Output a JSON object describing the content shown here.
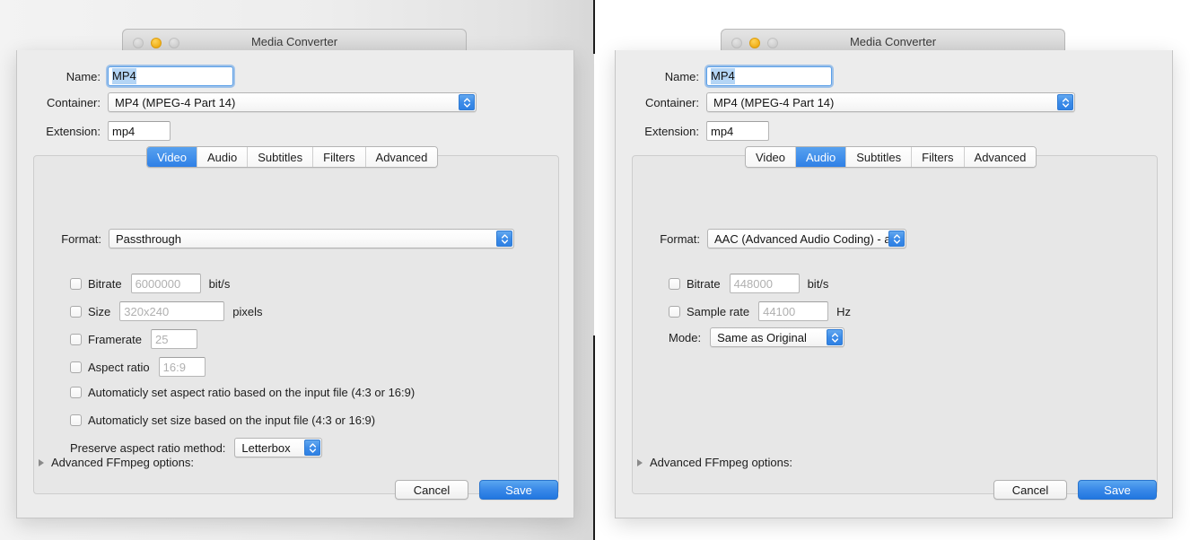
{
  "window": {
    "title": "Media Converter",
    "traffic_lights": [
      "close-button-inactive",
      "minimize-button-amber",
      "zoom-button-inactive"
    ]
  },
  "colors": {
    "accent_blue": "#2f80e6",
    "selection_blue": "#b4d5f5",
    "sheet_bg": "#ececec",
    "content_bg": "#e7e7e7",
    "amber": "#f7b316"
  },
  "form": {
    "name_label": "Name:",
    "name_value": "MP4",
    "container_label": "Container:",
    "container_value": "MP4 (MPEG-4 Part 14)",
    "extension_label": "Extension:",
    "extension_value": "mp4"
  },
  "tabs": [
    {
      "label": "Video"
    },
    {
      "label": "Audio"
    },
    {
      "label": "Subtitles"
    },
    {
      "label": "Filters"
    },
    {
      "label": "Advanced"
    }
  ],
  "left_panel": {
    "active_tab": "Video",
    "format_label": "Format:",
    "format_value": "Passthrough",
    "bitrate_label": "Bitrate",
    "bitrate_placeholder": "6000000",
    "bitrate_unit": "bit/s",
    "size_label": "Size",
    "size_placeholder": "320x240",
    "size_unit": "pixels",
    "framerate_label": "Framerate",
    "framerate_placeholder": "25",
    "aspect_label": "Aspect ratio",
    "aspect_placeholder": "16:9",
    "auto_aspect_label": "Automaticly set aspect ratio based on the input file (4:3 or 16:9)",
    "auto_size_label": "Automaticly set size based on the input file (4:3 or 16:9)",
    "preserve_label": "Preserve aspect ratio method:",
    "preserve_value": "Letterbox"
  },
  "right_panel": {
    "active_tab": "Audio",
    "format_label": "Format:",
    "format_value": "AAC (Advanced Audio Coding)  - aac",
    "bitrate_label": "Bitrate",
    "bitrate_placeholder": "448000",
    "bitrate_unit": "bit/s",
    "samplerate_label": "Sample rate",
    "samplerate_placeholder": "44100",
    "samplerate_unit": "Hz",
    "mode_label": "Mode:",
    "mode_value": "Same as Original"
  },
  "footer": {
    "advanced_label": "Advanced FFmpeg options:",
    "cancel_label": "Cancel",
    "save_label": "Save"
  }
}
